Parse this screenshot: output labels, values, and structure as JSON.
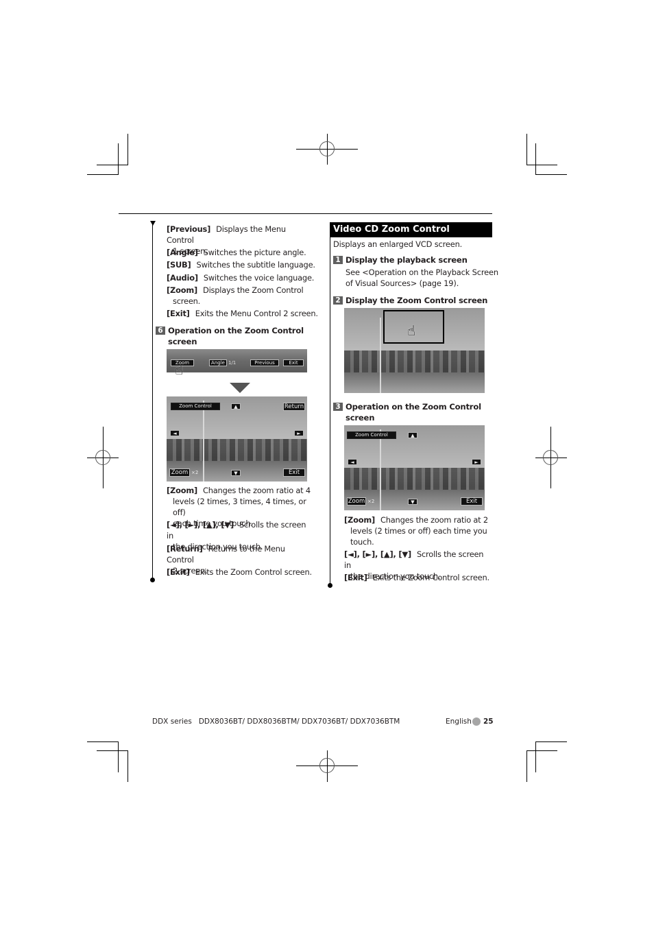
{
  "left_column": {
    "items": [
      {
        "key": "[Previous]",
        "desc": "Displays the Menu Control",
        "cont": "1 screen."
      },
      {
        "key": "[Angle]",
        "desc": "Switches the picture angle."
      },
      {
        "key": "[SUB]",
        "desc": "Switches the subtitle language."
      },
      {
        "key": "[Audio]",
        "desc": "Switches the voice language."
      },
      {
        "key": "[Zoom]",
        "desc": "Displays the Zoom Control",
        "cont": "screen."
      },
      {
        "key": "[Exit]",
        "desc": "Exits the Menu Control 2 screen."
      }
    ],
    "step6": {
      "number": "6",
      "title_line1": "Operation on the Zoom Control",
      "title_line2": "screen",
      "menu_bar": {
        "zoom": "Zoom",
        "angle": "Angle",
        "angle_value": "1/1",
        "previous": "Previous",
        "exit": "Exit"
      },
      "zoom_screen": {
        "title": "Zoom Control",
        "return": "Return",
        "zoom": "Zoom",
        "zoom_ratio": "×2",
        "exit": "Exit"
      }
    },
    "items2": [
      {
        "key": "[Zoom]",
        "desc": "Changes the zoom ratio at 4",
        "cont1": "levels (2 times, 3 times, 4 times, or off)",
        "cont2": "each time you touch."
      },
      {
        "key": "[◄], [►], [▲], [▼]",
        "desc": "Scrolls the screen in",
        "cont1": "the direction you touch."
      },
      {
        "key": "[Return]",
        "desc": "Returns to the Menu Control",
        "cont1": "2 screen."
      },
      {
        "key": "[Exit]",
        "desc": "Exits the Zoom Control screen."
      }
    ]
  },
  "right_column": {
    "section_title": "Video CD Zoom Control",
    "intro": "Displays an enlarged VCD screen.",
    "step1": {
      "number": "1",
      "title": "Display the playback screen",
      "body_line1": "See <Operation on the Playback Screen",
      "body_line2": "of Visual Sources> (page 19)."
    },
    "step2": {
      "number": "2",
      "title": "Display the Zoom Control screen"
    },
    "step3": {
      "number": "3",
      "title_line1": "Operation on the Zoom Control",
      "title_line2": "screen",
      "zoom_screen": {
        "title": "Zoom Control",
        "zoom": "Zoom",
        "zoom_ratio": "×2",
        "exit": "Exit"
      }
    },
    "items": [
      {
        "key": "[Zoom]",
        "desc": "Changes the zoom ratio at 2",
        "cont1": "levels (2 times or off) each time you",
        "cont2": "touch."
      },
      {
        "key": "[◄], [►], [▲], [▼]",
        "desc": "Scrolls the screen in",
        "cont1": "the direction you touch."
      },
      {
        "key": "[Exit]",
        "desc": "Exits the Zoom Control screen."
      }
    ]
  },
  "footer": {
    "series": "DDX series",
    "models": "DDX8036BT/ DDX8036BTM/ DDX7036BT/ DDX7036BTM",
    "language": "English",
    "page": "25"
  },
  "colors": {
    "step_badge": "#5f5f5f",
    "section_head_bg": "#000000",
    "page_dot": "#a6a6a6"
  }
}
